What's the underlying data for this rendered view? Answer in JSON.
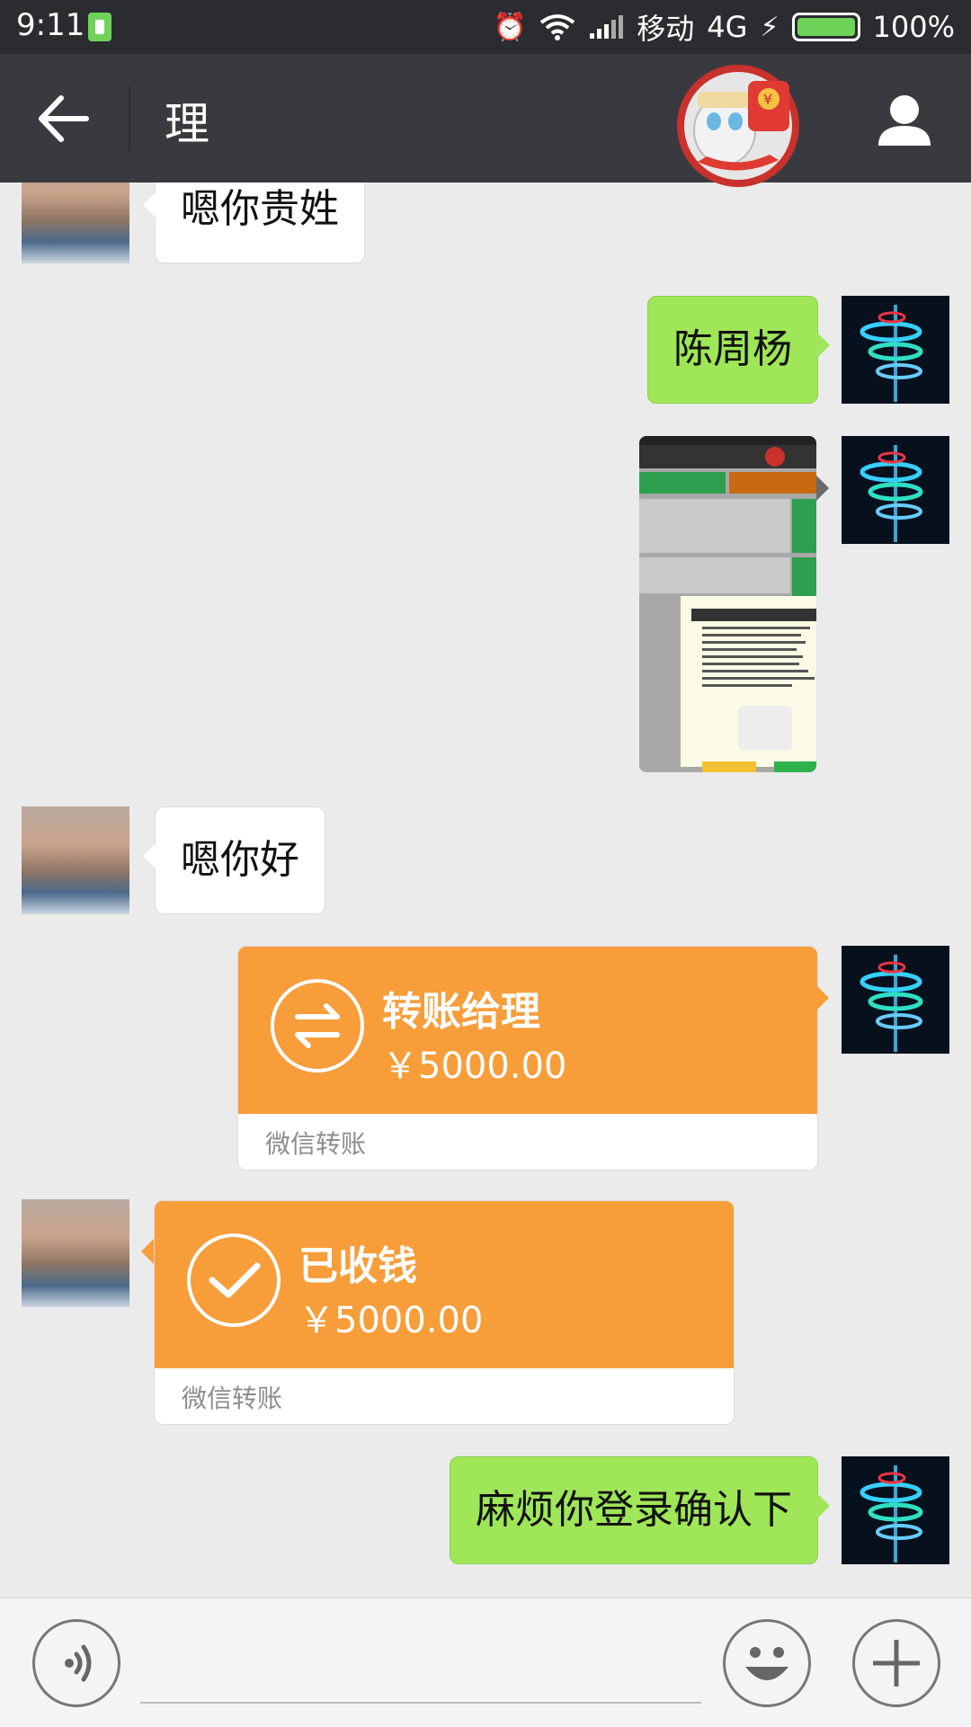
{
  "status_bar": {
    "time": "9:11",
    "carrier": "移动",
    "network": "4G",
    "battery": "100%"
  },
  "header": {
    "title": "理"
  },
  "messages": {
    "m1": {
      "text": "嗯你贵姓"
    },
    "m2": {
      "text": "陈周杨"
    },
    "m4": {
      "text": "嗯你好"
    },
    "m5": {
      "title": "转账给理",
      "amount": "￥5000.00",
      "footer": "微信转账"
    },
    "m6": {
      "title": "已收钱",
      "amount": "￥5000.00",
      "footer": "微信转账"
    },
    "m7": {
      "text": "麻烦你登录确认下"
    }
  },
  "colors": {
    "header_bg": "#393a3f",
    "chat_bg": "#ebebeb",
    "green_bubble": "#9fe658",
    "transfer_orange": "#f79d3a"
  },
  "icons": {
    "back": "arrow-left-icon",
    "profile": "person-icon",
    "voice": "voice-icon",
    "emoji": "smiley-icon",
    "more": "plus-icon"
  }
}
